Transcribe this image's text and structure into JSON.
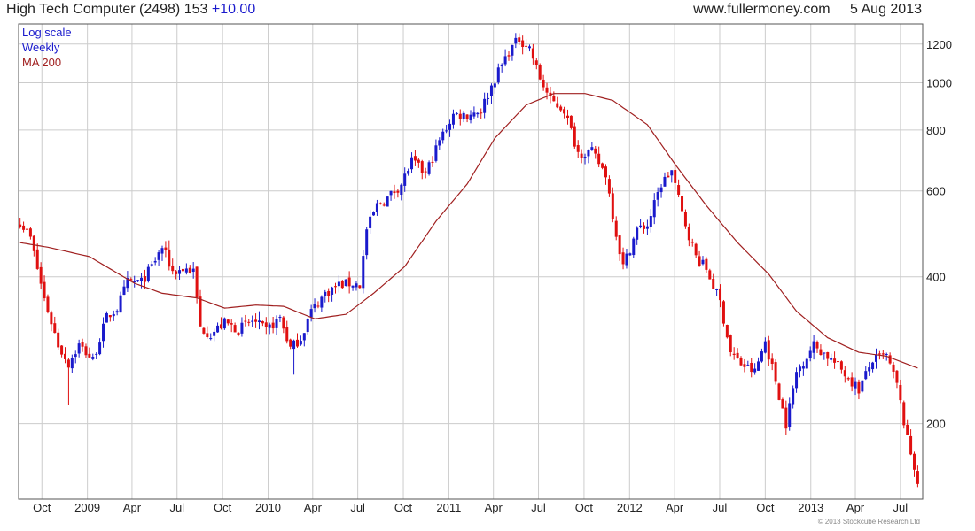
{
  "header": {
    "title": "High Tech Computer (2498) 153",
    "change": "+10.00",
    "source": "www.fullermoney.com",
    "date": "5 Aug 2013"
  },
  "legend": {
    "scale": "Log scale",
    "period": "Weekly",
    "ma": "MA 200"
  },
  "copyright": "© 2013 Stockcube Research Ltd",
  "colors": {
    "up": "#1a1acc",
    "down": "#e01010",
    "ma": "#a02020",
    "scale_text": "#1a1acc",
    "ma_text": "#a02020",
    "grid": "#cccccc"
  },
  "chart_data": {
    "type": "candlestick",
    "scale": "log",
    "ylim": [
      140,
      1320
    ],
    "yticks": [
      200,
      400,
      600,
      800,
      1000,
      1200
    ],
    "ytick_labels": [
      "200",
      "400",
      "600",
      "800",
      "1000",
      "1200"
    ],
    "xrange": [
      "2008-08-15",
      "2013-08-15"
    ],
    "xticks": [
      {
        "label": "Oct",
        "date": "2008-10-01"
      },
      {
        "label": "2009",
        "date": "2009-01-01"
      },
      {
        "label": "Apr",
        "date": "2009-04-01"
      },
      {
        "label": "Jul",
        "date": "2009-07-01"
      },
      {
        "label": "Oct",
        "date": "2009-10-01"
      },
      {
        "label": "2010",
        "date": "2010-01-01"
      },
      {
        "label": "Apr",
        "date": "2010-04-01"
      },
      {
        "label": "Jul",
        "date": "2010-07-01"
      },
      {
        "label": "Oct",
        "date": "2010-10-01"
      },
      {
        "label": "2011",
        "date": "2011-01-01"
      },
      {
        "label": "Apr",
        "date": "2011-04-01"
      },
      {
        "label": "Jul",
        "date": "2011-07-01"
      },
      {
        "label": "Oct",
        "date": "2011-10-01"
      },
      {
        "label": "2012",
        "date": "2012-01-01"
      },
      {
        "label": "Apr",
        "date": "2012-04-01"
      },
      {
        "label": "Jul",
        "date": "2012-07-01"
      },
      {
        "label": "Oct",
        "date": "2012-10-01"
      },
      {
        "label": "2013",
        "date": "2013-01-01"
      },
      {
        "label": "Apr",
        "date": "2013-04-01"
      },
      {
        "label": "Jul",
        "date": "2013-07-01"
      }
    ],
    "close_anchors": [
      [
        "2008-08-18",
        520
      ],
      [
        "2008-09-08",
        480
      ],
      [
        "2008-10-06",
        360
      ],
      [
        "2008-11-03",
        290
      ],
      [
        "2008-11-24",
        265
      ],
      [
        "2008-12-15",
        290
      ],
      [
        "2009-01-12",
        270
      ],
      [
        "2009-02-09",
        330
      ],
      [
        "2009-03-02",
        345
      ],
      [
        "2009-03-23",
        390
      ],
      [
        "2009-04-20",
        390
      ],
      [
        "2009-05-11",
        420
      ],
      [
        "2009-06-01",
        460
      ],
      [
        "2009-06-22",
        410
      ],
      [
        "2009-07-20",
        415
      ],
      [
        "2009-08-03",
        410
      ],
      [
        "2009-08-17",
        315
      ],
      [
        "2009-09-07",
        305
      ],
      [
        "2009-10-05",
        322
      ],
      [
        "2009-11-02",
        312
      ],
      [
        "2009-11-30",
        325
      ],
      [
        "2009-12-28",
        310
      ],
      [
        "2010-01-25",
        330
      ],
      [
        "2010-02-15",
        285
      ],
      [
        "2010-03-08",
        300
      ],
      [
        "2010-03-29",
        340
      ],
      [
        "2010-04-26",
        370
      ],
      [
        "2010-05-24",
        385
      ],
      [
        "2010-06-21",
        388
      ],
      [
        "2010-07-05",
        385
      ],
      [
        "2010-07-19",
        500
      ],
      [
        "2010-08-09",
        560
      ],
      [
        "2010-08-30",
        580
      ],
      [
        "2010-09-27",
        620
      ],
      [
        "2010-10-18",
        690
      ],
      [
        "2010-11-15",
        650
      ],
      [
        "2010-12-13",
        760
      ],
      [
        "2011-01-10",
        860
      ],
      [
        "2011-02-07",
        860
      ],
      [
        "2011-03-07",
        880
      ],
      [
        "2011-04-04",
        1020
      ],
      [
        "2011-05-02",
        1160
      ],
      [
        "2011-05-23",
        1230
      ],
      [
        "2011-06-13",
        1180
      ],
      [
        "2011-07-04",
        1020
      ],
      [
        "2011-07-25",
        920
      ],
      [
        "2011-08-22",
        880
      ],
      [
        "2011-09-19",
        720
      ],
      [
        "2011-10-17",
        720
      ],
      [
        "2011-11-14",
        650
      ],
      [
        "2011-12-05",
        490
      ],
      [
        "2011-12-19",
        420
      ],
      [
        "2012-01-16",
        500
      ],
      [
        "2012-02-06",
        510
      ],
      [
        "2012-03-05",
        620
      ],
      [
        "2012-03-26",
        660
      ],
      [
        "2012-04-16",
        540
      ],
      [
        "2012-05-14",
        440
      ],
      [
        "2012-06-04",
        415
      ],
      [
        "2012-07-02",
        355
      ],
      [
        "2012-07-23",
        280
      ],
      [
        "2012-08-13",
        265
      ],
      [
        "2012-09-10",
        255
      ],
      [
        "2012-10-01",
        295
      ],
      [
        "2012-10-22",
        245
      ],
      [
        "2012-11-12",
        200
      ],
      [
        "2012-12-03",
        255
      ],
      [
        "2013-01-07",
        290
      ],
      [
        "2013-02-04",
        275
      ],
      [
        "2013-03-04",
        258
      ],
      [
        "2013-04-08",
        235
      ],
      [
        "2013-05-06",
        270
      ],
      [
        "2013-06-03",
        275
      ],
      [
        "2013-06-24",
        240
      ],
      [
        "2013-07-15",
        185
      ],
      [
        "2013-08-05",
        153
      ]
    ],
    "spikes": [
      {
        "date": "2008-11-24",
        "low": 218
      },
      {
        "date": "2009-06-15",
        "high": 475
      },
      {
        "date": "2009-12-14",
        "high": 340
      },
      {
        "date": "2010-02-22",
        "low": 252
      },
      {
        "date": "2011-05-23",
        "high": 1240
      },
      {
        "date": "2011-07-25",
        "high": 975
      },
      {
        "date": "2012-11-12",
        "low": 190
      },
      {
        "date": "2013-08-05",
        "low": 150
      }
    ],
    "ma200_anchors": [
      [
        "2008-08-18",
        470
      ],
      [
        "2008-10-13",
        460
      ],
      [
        "2009-01-05",
        440
      ],
      [
        "2009-04-06",
        388
      ],
      [
        "2009-06-01",
        370
      ],
      [
        "2009-08-10",
        362
      ],
      [
        "2009-10-05",
        345
      ],
      [
        "2009-12-07",
        350
      ],
      [
        "2010-02-01",
        348
      ],
      [
        "2010-04-05",
        328
      ],
      [
        "2010-06-07",
        335
      ],
      [
        "2010-08-02",
        370
      ],
      [
        "2010-10-04",
        420
      ],
      [
        "2010-12-06",
        520
      ],
      [
        "2011-02-07",
        620
      ],
      [
        "2011-04-04",
        770
      ],
      [
        "2011-06-06",
        900
      ],
      [
        "2011-08-01",
        950
      ],
      [
        "2011-10-03",
        950
      ],
      [
        "2011-11-28",
        920
      ],
      [
        "2012-02-06",
        820
      ],
      [
        "2012-04-02",
        680
      ],
      [
        "2012-06-04",
        560
      ],
      [
        "2012-08-06",
        470
      ],
      [
        "2012-10-08",
        405
      ],
      [
        "2012-12-03",
        340
      ],
      [
        "2013-02-04",
        300
      ],
      [
        "2013-04-08",
        280
      ],
      [
        "2013-06-03",
        275
      ],
      [
        "2013-08-05",
        260
      ]
    ]
  }
}
